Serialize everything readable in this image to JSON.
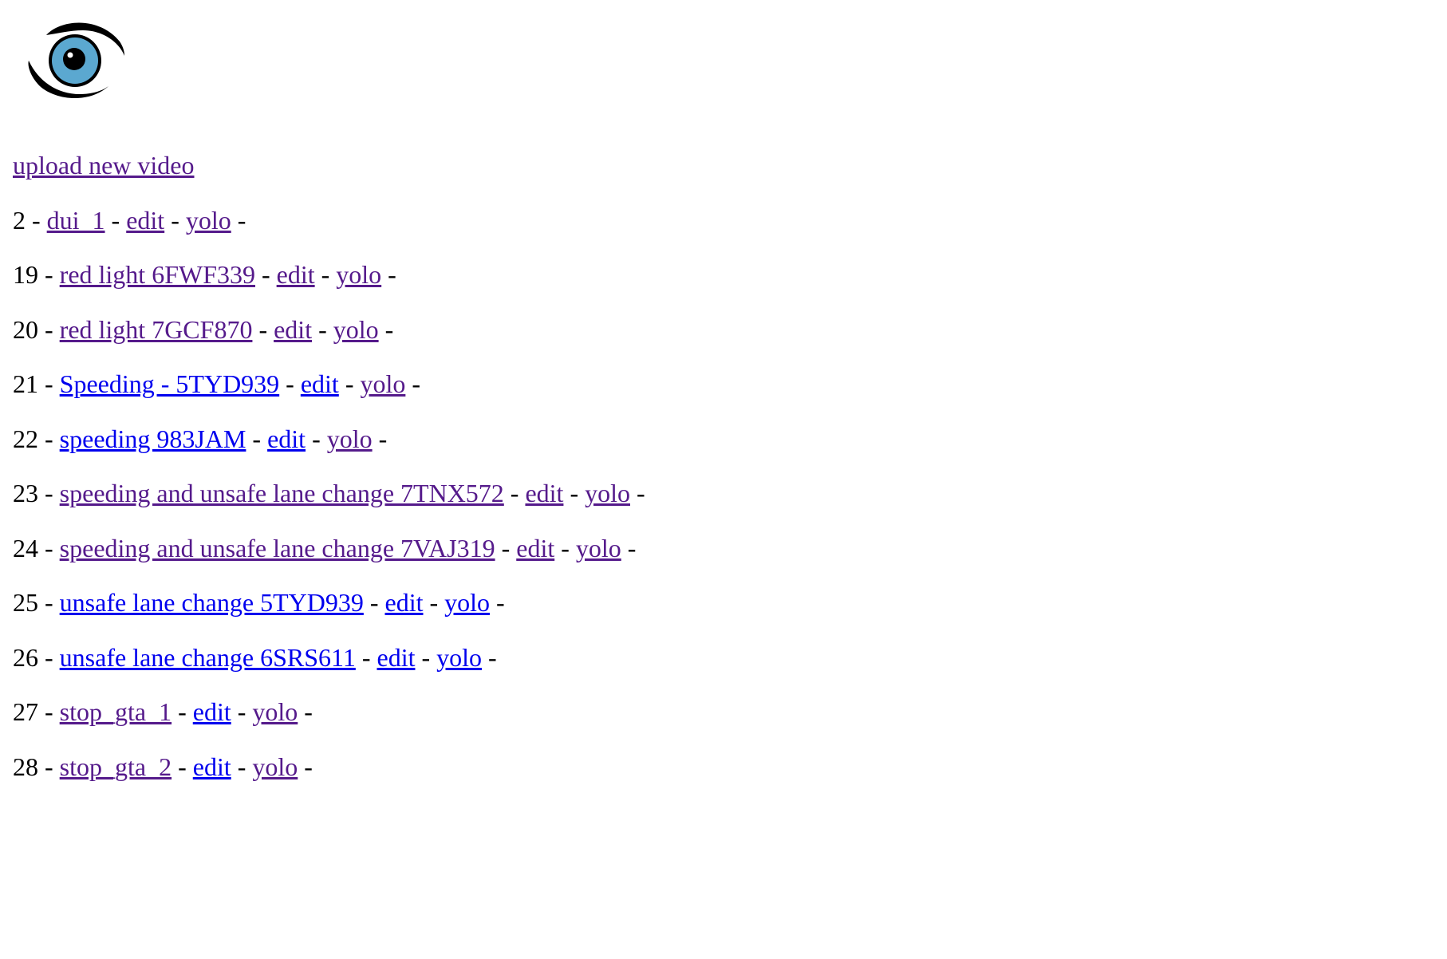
{
  "page": {
    "upload_link": "upload new video",
    "separator": "-"
  },
  "colors": {
    "visited_link": "#551a8b",
    "unvisited_link": "#0000ee",
    "logo_iris": "#5ba8d0",
    "logo_pupil": "#000000"
  },
  "videos": [
    {
      "id": "2",
      "title": "dui_1",
      "edit": "edit",
      "yolo": "yolo",
      "title_visited": true,
      "edit_visited": true,
      "yolo_visited": true
    },
    {
      "id": "19",
      "title": "red light 6FWF339",
      "edit": "edit",
      "yolo": "yolo",
      "title_visited": true,
      "edit_visited": true,
      "yolo_visited": true
    },
    {
      "id": "20",
      "title": "red light 7GCF870",
      "edit": "edit",
      "yolo": "yolo",
      "title_visited": true,
      "edit_visited": true,
      "yolo_visited": true
    },
    {
      "id": "21",
      "title": "Speeding - 5TYD939",
      "edit": "edit",
      "yolo": "yolo",
      "title_visited": false,
      "edit_visited": false,
      "yolo_visited": true
    },
    {
      "id": "22",
      "title": "speeding 983JAM",
      "edit": "edit",
      "yolo": "yolo",
      "title_visited": false,
      "edit_visited": false,
      "yolo_visited": true
    },
    {
      "id": "23",
      "title": "speeding and unsafe lane change 7TNX572",
      "edit": "edit",
      "yolo": "yolo",
      "title_visited": true,
      "edit_visited": true,
      "yolo_visited": true
    },
    {
      "id": "24",
      "title": "speeding and unsafe lane change 7VAJ319",
      "edit": "edit",
      "yolo": "yolo",
      "title_visited": true,
      "edit_visited": true,
      "yolo_visited": true
    },
    {
      "id": "25",
      "title": "unsafe lane change 5TYD939",
      "edit": "edit",
      "yolo": "yolo",
      "title_visited": false,
      "edit_visited": false,
      "yolo_visited": false
    },
    {
      "id": "26",
      "title": "unsafe lane change 6SRS611",
      "edit": "edit",
      "yolo": "yolo",
      "title_visited": false,
      "edit_visited": false,
      "yolo_visited": false
    },
    {
      "id": "27",
      "title": "stop_gta_1",
      "edit": "edit",
      "yolo": "yolo",
      "title_visited": true,
      "edit_visited": false,
      "yolo_visited": true
    },
    {
      "id": "28",
      "title": "stop_gta_2",
      "edit": "edit",
      "yolo": "yolo",
      "title_visited": true,
      "edit_visited": false,
      "yolo_visited": true
    }
  ]
}
